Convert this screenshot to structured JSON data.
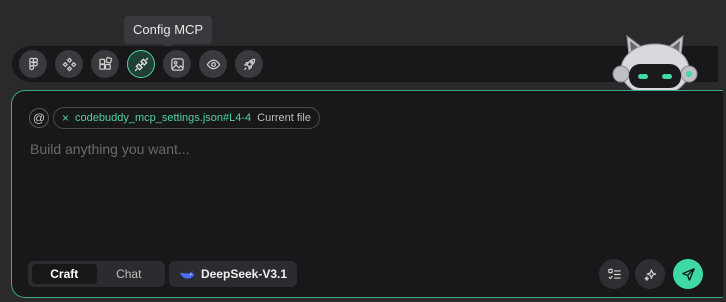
{
  "tooltip": {
    "text": "Config MCP"
  },
  "toolbar": {
    "buttons": [
      {
        "icon": "figma-icon"
      },
      {
        "icon": "components-icon"
      },
      {
        "icon": "blocks-icon"
      },
      {
        "icon": "plug-icon",
        "active": true
      },
      {
        "icon": "image-icon"
      },
      {
        "icon": "eye-icon"
      },
      {
        "icon": "rocket-icon"
      }
    ]
  },
  "context": {
    "at_symbol": "@",
    "file_chip": {
      "remove_symbol": "×",
      "name": "codebuddy_mcp_settings.json#L4-4",
      "hint": "Current file"
    }
  },
  "input": {
    "placeholder": "Build anything you want..."
  },
  "mode": {
    "options": [
      "Craft",
      "Chat"
    ],
    "selected": "Craft"
  },
  "model": {
    "name": "DeepSeek-V3.1",
    "icon": "whale-icon"
  },
  "colors": {
    "accent": "#3ed9a6",
    "panel_bg": "#18181a",
    "page_bg": "#2a2a2d",
    "border_active": "#3aa98a"
  }
}
